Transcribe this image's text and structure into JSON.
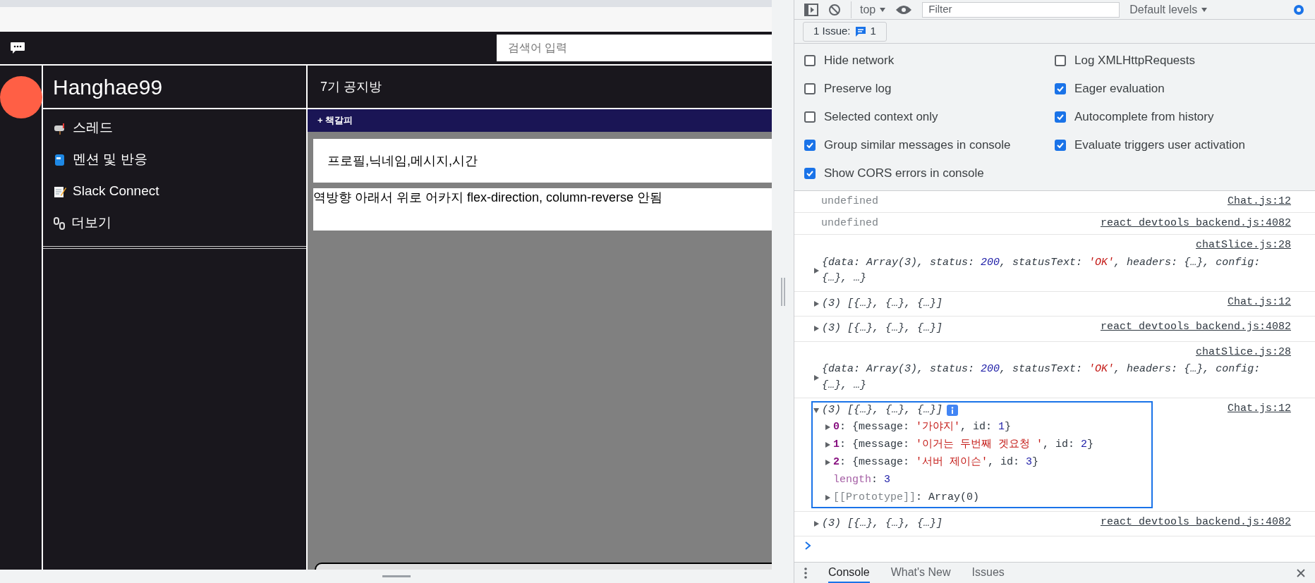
{
  "app": {
    "search": {
      "placeholder": "검색어 입력"
    },
    "workspace": {
      "name": "Hanghae99"
    },
    "sidebar_items": [
      {
        "label": "스레드"
      },
      {
        "label": "멘션 및 반응"
      },
      {
        "label": "Slack Connect"
      },
      {
        "label": "더보기"
      }
    ],
    "channel": {
      "title": "7기 공지방"
    },
    "bookmark_button": "+ 책갈피",
    "messages": [
      {
        "text": "프로필,닉네임,메시지,시간"
      },
      {
        "text": "역방향 아래서 위로 어카지 flex-direction, column-reverse 안됨"
      }
    ]
  },
  "devtools": {
    "toolbar": {
      "context": "top",
      "filter": {
        "placeholder": "Filter"
      },
      "levels": "Default levels"
    },
    "issues": {
      "label": "1 Issue:",
      "count": "1"
    },
    "settings": [
      {
        "label": "Hide network",
        "checked": false
      },
      {
        "label": "Log XMLHttpRequests",
        "checked": false
      },
      {
        "label": "Preserve log",
        "checked": false
      },
      {
        "label": "Eager evaluation",
        "checked": true
      },
      {
        "label": "Selected context only",
        "checked": false
      },
      {
        "label": "Autocomplete from history",
        "checked": true
      },
      {
        "label": "Group similar messages in console",
        "checked": true
      },
      {
        "label": "Evaluate triggers user activation",
        "checked": true
      },
      {
        "label": "Show CORS errors in console",
        "checked": true
      }
    ],
    "console": [
      {
        "kind": "text",
        "text": "undefined",
        "source": "Chat.js:12",
        "focused": false
      },
      {
        "kind": "text",
        "text": "undefined",
        "source": "react_devtools_backend.js:4082",
        "focused": false
      },
      {
        "kind": "object",
        "expanded": false,
        "source": "chatSlice.js:28",
        "focused": false,
        "segments": [
          {
            "t": "{data: Array(3), status: ",
            "kind": "plain"
          },
          {
            "t": "200",
            "kind": "number"
          },
          {
            "t": ", statusText: ",
            "kind": "plain"
          },
          {
            "t": "'OK'",
            "kind": "string"
          },
          {
            "t": ", headers: {…}, config: {…}, …}",
            "kind": "plain"
          }
        ]
      },
      {
        "kind": "array",
        "expanded": false,
        "source": "Chat.js:12",
        "focused": false,
        "summary": "(3) [{…}, {…}, {…}]"
      },
      {
        "kind": "array",
        "expanded": false,
        "source": "react_devtools_backend.js:4082",
        "focused": false,
        "summary": "(3) [{…}, {…}, {…}]"
      },
      {
        "kind": "object",
        "expanded": false,
        "source": "chatSlice.js:28",
        "focused": false,
        "segments": [
          {
            "t": "{data: Array(3), status: ",
            "kind": "plain"
          },
          {
            "t": "200",
            "kind": "number"
          },
          {
            "t": ", statusText: ",
            "kind": "plain"
          },
          {
            "t": "'OK'",
            "kind": "string"
          },
          {
            "t": ", headers: {…}, config: {…}, …}",
            "kind": "plain"
          }
        ]
      },
      {
        "kind": "array",
        "expanded": true,
        "source": "Chat.js:12",
        "focused": true,
        "summary": "(3) [{…}, {…}, {…}]",
        "children": [
          {
            "kind": "expandable",
            "expanded": false,
            "segments": [
              {
                "t": "0",
                "kind": "key"
              },
              {
                "t": ": {message: ",
                "kind": "plain"
              },
              {
                "t": "'가야지'",
                "kind": "string"
              },
              {
                "t": ", id: ",
                "kind": "plain"
              },
              {
                "t": "1",
                "kind": "number"
              },
              {
                "t": "}",
                "kind": "plain"
              }
            ]
          },
          {
            "kind": "expandable",
            "expanded": false,
            "segments": [
              {
                "t": "1",
                "kind": "key"
              },
              {
                "t": ": {message: ",
                "kind": "plain"
              },
              {
                "t": "'이거는 두번째 겟요청 '",
                "kind": "string"
              },
              {
                "t": ", id: ",
                "kind": "plain"
              },
              {
                "t": "2",
                "kind": "number"
              },
              {
                "t": "}",
                "kind": "plain"
              }
            ]
          },
          {
            "kind": "expandable",
            "expanded": false,
            "segments": [
              {
                "t": "2",
                "kind": "key"
              },
              {
                "t": ": {message: ",
                "kind": "plain"
              },
              {
                "t": "'서버 제이슨'",
                "kind": "string"
              },
              {
                "t": ", id: ",
                "kind": "plain"
              },
              {
                "t": "3",
                "kind": "number"
              },
              {
                "t": "}",
                "kind": "plain"
              }
            ]
          },
          {
            "kind": "property",
            "segments": [
              {
                "t": "length",
                "kind": "prop"
              },
              {
                "t": ": ",
                "kind": "plain"
              },
              {
                "t": "3",
                "kind": "number"
              }
            ]
          },
          {
            "kind": "expandable",
            "expanded": false,
            "segments": [
              {
                "t": "[[Prototype]]",
                "kind": "dim"
              },
              {
                "t": ": Array(0)",
                "kind": "plain"
              }
            ]
          }
        ]
      },
      {
        "kind": "array",
        "expanded": false,
        "source": "react_devtools_backend.js:4082",
        "focused": false,
        "summary": "(3) [{…}, {…}, {…}]"
      }
    ],
    "tabs": [
      {
        "label": "Console",
        "selected": true
      },
      {
        "label": "What's New",
        "selected": false
      },
      {
        "label": "Issues",
        "selected": false
      }
    ]
  }
}
